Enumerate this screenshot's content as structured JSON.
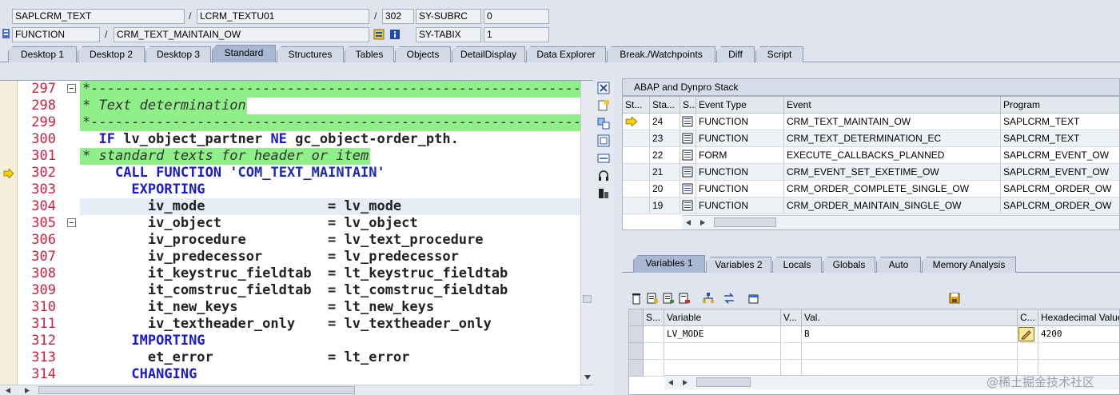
{
  "header": {
    "row1": {
      "main_program": "SAPLCRM_TEXT",
      "include": "LCRM_TEXTU01",
      "line": "302",
      "sysvar_name": "SY-SUBRC",
      "sysvar_value": "0"
    },
    "row2": {
      "event_type": "FUNCTION",
      "event_name": "CRM_TEXT_MAINTAIN_OW",
      "sysvar_name": "SY-TABIX",
      "sysvar_value": "1"
    },
    "separator": "/"
  },
  "tabs": [
    {
      "label": "Desktop 1"
    },
    {
      "label": "Desktop 2"
    },
    {
      "label": "Desktop 3"
    },
    {
      "label": "Standard",
      "active": true
    },
    {
      "label": "Structures"
    },
    {
      "label": "Tables"
    },
    {
      "label": "Objects"
    },
    {
      "label": "DetailDisplay"
    },
    {
      "label": "Data Explorer"
    },
    {
      "label": "Break./Watchpoints"
    },
    {
      "label": "Diff"
    },
    {
      "label": "Script"
    }
  ],
  "code": {
    "current_line": "302",
    "lines": [
      {
        "no": "297",
        "text": "*---------------------------------------------------------------",
        "kind": "comment-box"
      },
      {
        "no": "298",
        "text": "* Text determination",
        "kind": "comment-box"
      },
      {
        "no": "299",
        "text": "*---------------------------------------------------------------",
        "kind": "comment-box"
      },
      {
        "no": "300",
        "text": "  IF lv_object_partner NE gc_object-order_pth."
      },
      {
        "no": "301",
        "text": "* standard texts for header or item",
        "kind": "comment"
      },
      {
        "no": "302",
        "text": "    CALL FUNCTION 'COM_TEXT_MAINTAIN'"
      },
      {
        "no": "303",
        "text": "      EXPORTING"
      },
      {
        "no": "304",
        "text": "        iv_mode               = lv_mode"
      },
      {
        "no": "305",
        "text": "        iv_object             = lv_object"
      },
      {
        "no": "306",
        "text": "        iv_procedure          = lv_text_procedure"
      },
      {
        "no": "307",
        "text": "        iv_predecessor        = lv_predecessor"
      },
      {
        "no": "308",
        "text": "        it_keystruc_fieldtab  = lt_keystruc_fieldtab"
      },
      {
        "no": "309",
        "text": "        it_comstruc_fieldtab  = lt_comstruc_fieldtab"
      },
      {
        "no": "310",
        "text": "        it_new_keys           = lt_new_keys"
      },
      {
        "no": "311",
        "text": "        iv_textheader_only    = lv_textheader_only"
      },
      {
        "no": "312",
        "text": "      IMPORTING"
      },
      {
        "no": "313",
        "text": "        et_error              = lt_error"
      },
      {
        "no": "314",
        "text": "      CHANGING"
      }
    ]
  },
  "stack": {
    "title": "ABAP and Dynpro Stack",
    "columns": [
      "St...",
      "Sta...",
      "S...",
      "Event Type",
      "Event",
      "Program"
    ],
    "rows": [
      {
        "sta": "24",
        "type": "FUNCTION",
        "event": "CRM_TEXT_MAINTAIN_OW",
        "program": "SAPLCRM_TEXT",
        "current": true
      },
      {
        "sta": "23",
        "type": "FUNCTION",
        "event": "CRM_TEXT_DETERMINATION_EC",
        "program": "SAPLCRM_TEXT"
      },
      {
        "sta": "22",
        "type": "FORM",
        "event": "EXECUTE_CALLBACKS_PLANNED",
        "program": "SAPLCRM_EVENT_OW"
      },
      {
        "sta": "21",
        "type": "FUNCTION",
        "event": "CRM_EVENT_SET_EXETIME_OW",
        "program": "SAPLCRM_EVENT_OW"
      },
      {
        "sta": "20",
        "type": "FUNCTION",
        "event": "CRM_ORDER_COMPLETE_SINGLE_OW",
        "program": "SAPLCRM_ORDER_OW"
      },
      {
        "sta": "19",
        "type": "FUNCTION",
        "event": "CRM_ORDER_MAINTAIN_SINGLE_OW",
        "program": "SAPLCRM_ORDER_OW"
      }
    ]
  },
  "var_tabs": [
    {
      "label": "Variables 1",
      "active": true
    },
    {
      "label": "Variables 2"
    },
    {
      "label": "Locals"
    },
    {
      "label": "Globals"
    },
    {
      "label": "Auto"
    },
    {
      "label": "Memory Analysis"
    }
  ],
  "variables": {
    "columns": [
      "S...",
      "Variable",
      "V...",
      "Val.",
      "C...",
      "Hexadecimal Value"
    ],
    "rows": [
      {
        "variable": "LV_MODE",
        "value": "B",
        "hex": "4200"
      }
    ]
  },
  "watermark": "@稀土掘金技术社区"
}
